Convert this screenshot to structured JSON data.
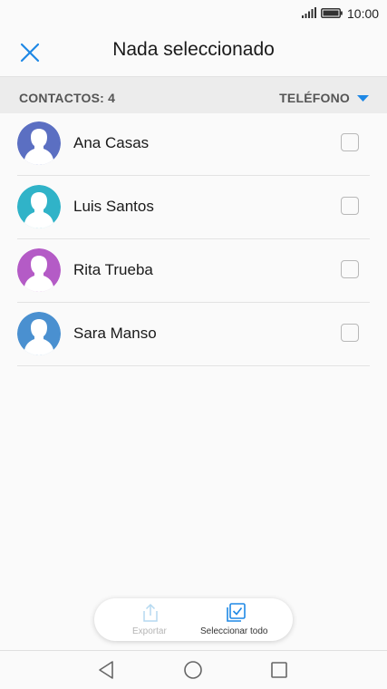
{
  "status_bar": {
    "time": "10:00",
    "icons": [
      "signal-icon",
      "battery-icon"
    ]
  },
  "header": {
    "close_icon": "close-icon",
    "title": "Nada seleccionado"
  },
  "sub_header": {
    "count_label": "CONTACTOS: 4",
    "filter_label": "TELÉFONO",
    "filter_icon": "caret-down-icon"
  },
  "contacts": [
    {
      "name": "Ana Casas",
      "avatar_color": "#5b6fc2",
      "checked": false
    },
    {
      "name": "Luis Santos",
      "avatar_color": "#30b3c8",
      "checked": false
    },
    {
      "name": "Rita Trueba",
      "avatar_color": "#b45bc6",
      "checked": false
    },
    {
      "name": "Sara Manso",
      "avatar_color": "#4a90d0",
      "checked": false
    }
  ],
  "actions": {
    "export_label": "Exportar",
    "export_enabled": false,
    "select_all_label": "Seleccionar todo"
  },
  "nav_bar": {
    "icons": [
      "back-icon",
      "home-icon",
      "recent-apps-icon"
    ]
  },
  "colors": {
    "accent": "#1e88e5",
    "disabled": "#b5d9f0"
  }
}
